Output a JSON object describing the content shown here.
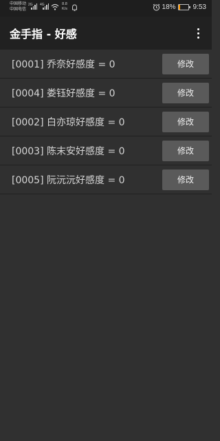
{
  "status_bar": {
    "carrier1": "中国移动",
    "carrier2": "中国电信",
    "net1": "2G",
    "net2": "4G",
    "speed_value": "8.8",
    "speed_unit": "K/s",
    "battery_percent": "18%",
    "battery_level": 0.18,
    "battery_color": "#ff9800",
    "time": "9:53",
    "icons": [
      "signal-icon",
      "wifi-icon",
      "notification-icon",
      "alarm-icon",
      "battery-icon"
    ]
  },
  "app_bar": {
    "title": "金手指 - 好感",
    "menu_icon": "more-vert-icon"
  },
  "items": [
    {
      "label": "[0001] 乔奈好感度 = 0",
      "button": "修改"
    },
    {
      "label": "[0004] 娄钰好感度 = 0",
      "button": "修改"
    },
    {
      "label": "[0002] 白亦琼好感度 = 0",
      "button": "修改"
    },
    {
      "label": "[0003] 陈末安好感度 = 0",
      "button": "修改"
    },
    {
      "label": "[0005] 阮沅沅好感度 = 0",
      "button": "修改"
    }
  ],
  "colors": {
    "background": "#303030",
    "app_bar": "#212121",
    "button": "#5a5a5a"
  }
}
